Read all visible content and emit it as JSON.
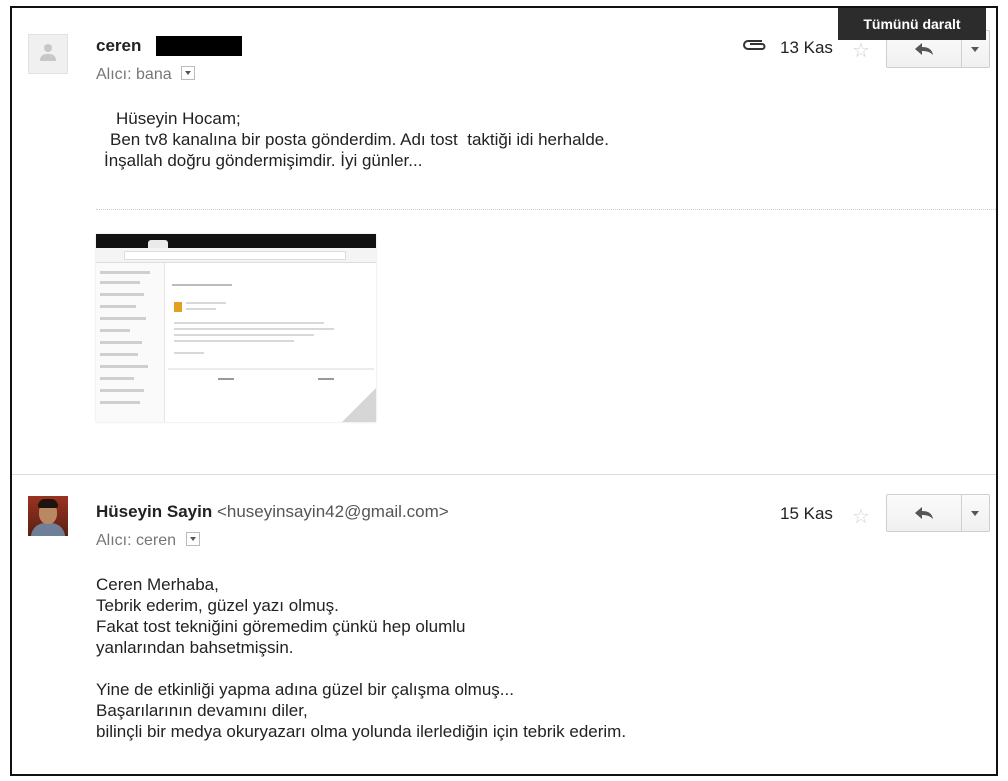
{
  "tooltip": {
    "collapse_all": "Tümünü daralt"
  },
  "messages": [
    {
      "sender": "ceren",
      "recipient_prefix": "Alıcı:",
      "recipient": "bana",
      "date": "13 Kas",
      "has_attachment": true,
      "body": [
        "Hüseyin Hocam;",
        "Ben tv8 kanalına bir posta gönderdim. Adı tost  taktiği idi herhalde.",
        "İnşallah doğru göndermişimdir. İyi günler..."
      ],
      "attachment": {
        "type": "screenshot-thumbnail"
      }
    },
    {
      "sender": "Hüseyin Sayin",
      "sender_email": "<huseyinsayin42@gmail.com>",
      "recipient_prefix": "Alıcı:",
      "recipient": "ceren",
      "date": "15 Kas",
      "body": [
        "Ceren Merhaba,",
        "Tebrik ederim, güzel yazı olmuş.",
        "Fakat tost tekniğini göremedim çünkü hep olumlu",
        "yanlarından bahsetmişsin.",
        "",
        "Yine de etkinliği yapma adına güzel bir çalışma olmuş...",
        "Başarılarının devamını diler,",
        "bilinçli bir medya okuryazarı olma yolunda ilerlediğin için tebrik ederim."
      ]
    }
  ],
  "icons": {
    "attachment": "paperclip-icon",
    "star": "star-icon",
    "reply": "reply-icon",
    "more": "chevron-down-icon",
    "recipient_details": "chevron-down-icon"
  },
  "colors": {
    "tooltip_bg": "#2c2c2c",
    "star": "#d0d0d0",
    "redaction": "#000000"
  }
}
